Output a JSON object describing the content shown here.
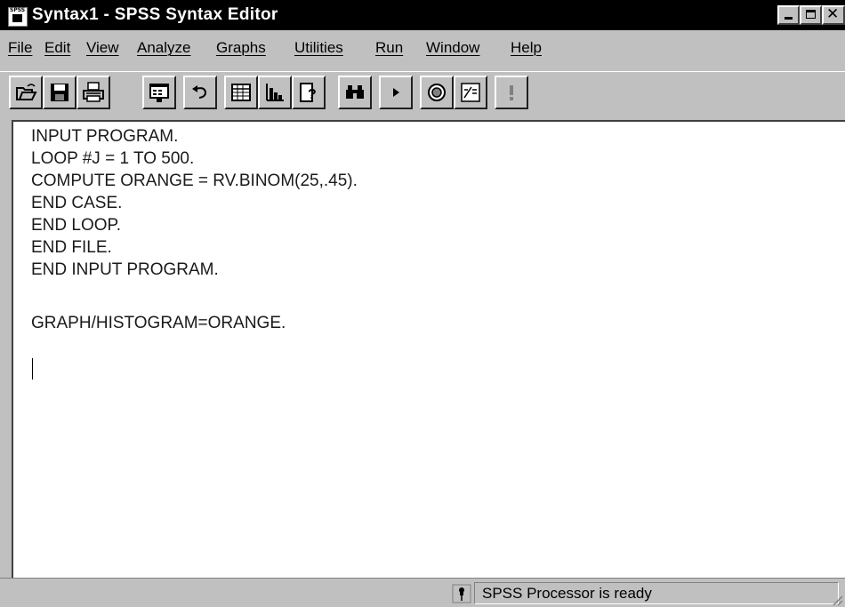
{
  "window": {
    "title": "Syntax1 - SPSS Syntax Editor",
    "icon_text": "SPSS"
  },
  "menu": {
    "items": [
      {
        "label": "File"
      },
      {
        "label": "Edit"
      },
      {
        "label": "View"
      },
      {
        "label": "Analyze"
      },
      {
        "label": "Graphs"
      },
      {
        "label": "Utilities"
      },
      {
        "label": "Run"
      },
      {
        "label": "Window"
      },
      {
        "label": "Help"
      }
    ]
  },
  "toolbar": {
    "buttons": [
      {
        "icon": "open-folder-icon"
      },
      {
        "icon": "save-disk-icon"
      },
      {
        "icon": "print-icon"
      },
      {
        "icon": "dialog-recall-icon"
      },
      {
        "icon": "undo-icon"
      },
      {
        "icon": "goto-data-icon"
      },
      {
        "icon": "goto-chart-icon"
      },
      {
        "icon": "variables-info-icon"
      },
      {
        "icon": "find-binoculars-icon"
      },
      {
        "icon": "run-play-icon"
      },
      {
        "icon": "designate-window-icon"
      },
      {
        "icon": "syntax-help-icon"
      },
      {
        "icon": "exclamation-icon"
      }
    ]
  },
  "editor": {
    "lines": [
      "INPUT PROGRAM.",
      "LOOP #J = 1 TO 500.",
      "COMPUTE ORANGE = RV.BINOM(25,.45).",
      "END CASE.",
      "END LOOP.",
      "END FILE.",
      "END INPUT PROGRAM.",
      "",
      "GRAPH/HISTOGRAM=ORANGE."
    ]
  },
  "status": {
    "text": "SPSS Processor  is ready"
  },
  "colors": {
    "titlebar": "#000000",
    "chrome": "#c0c0c0",
    "editor_bg": "#ffffff"
  }
}
